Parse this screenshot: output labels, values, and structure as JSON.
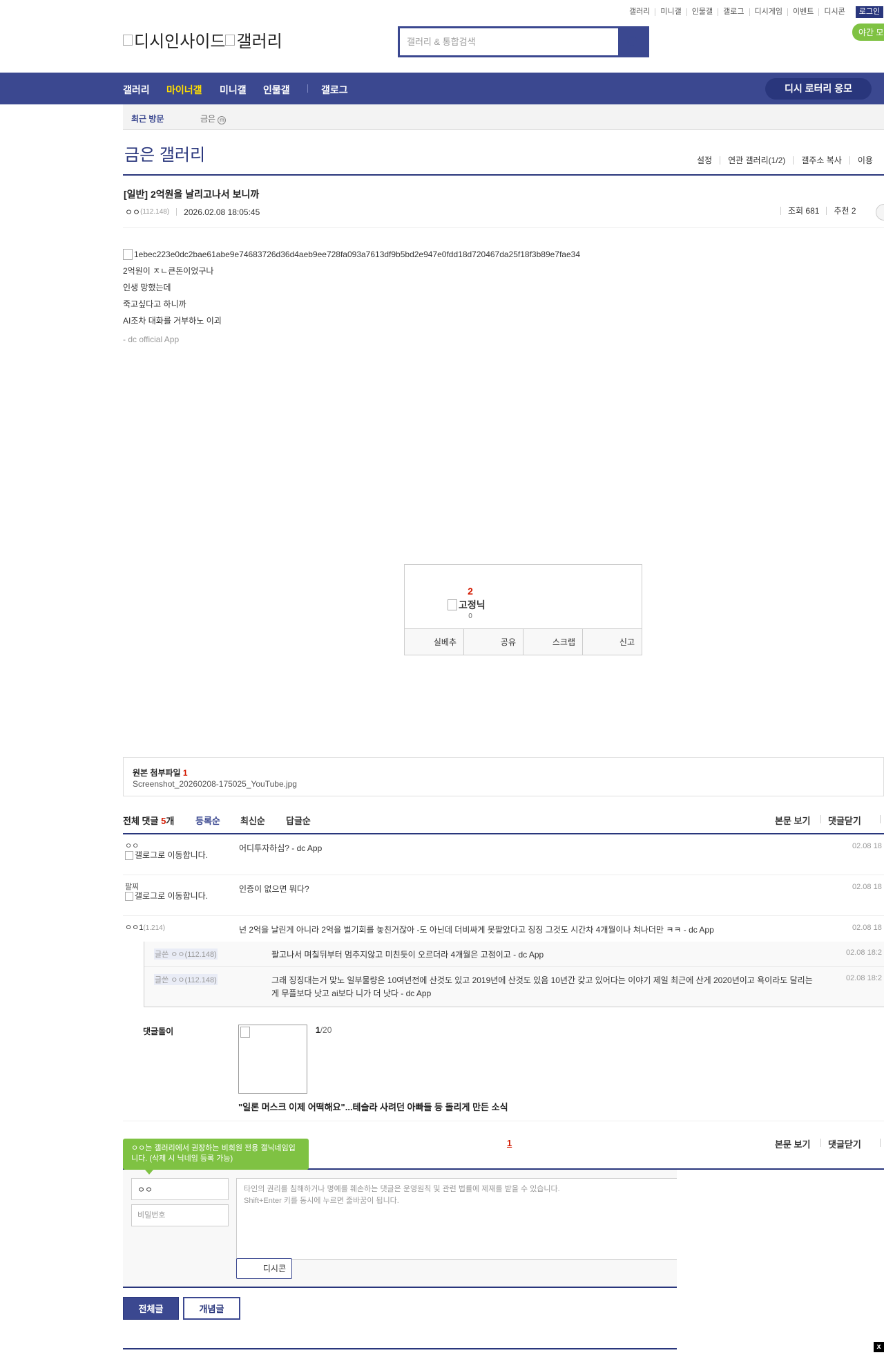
{
  "top_links": [
    "갤러리",
    "미니갤",
    "인물갤",
    "갤로그",
    "디시게임",
    "이벤트",
    "디시콘"
  ],
  "login_label": "로그인",
  "night_mode_label": "야간 모",
  "logo": {
    "left_alt": "디시인사이드",
    "right_alt": "갤러리"
  },
  "search": {
    "placeholder": "갤러리 & 통합검색"
  },
  "gnb": {
    "items": [
      "갤러리",
      "마이너갤",
      "미니갤",
      "인물갤",
      "갤로그"
    ],
    "active": "마이너갤",
    "lottery_label": "디시 로터리 응모"
  },
  "recent": {
    "title": "최근 방문",
    "item": "금은",
    "item_badge": "m"
  },
  "gallery": {
    "title": "금은 갤러리",
    "options": [
      "설정",
      "연관 갤러리(1/2)",
      "갤주소 복사",
      "이용"
    ]
  },
  "post": {
    "title": "[일반] 2억원을 날리고나서 보니까",
    "author": "ㅇㅇ",
    "author_ip": "(112.148)",
    "date": "2026.02.08 18:05:45",
    "views_label": "조회 681",
    "recommend_label": "추천 2",
    "image_alt": "1ebec223e0dc2bae61abe9e74683726d36d4aeb9ee728fa093a7613df9b5bd2e947e0fdd18d720467da25f18f3b89e7fae34",
    "lines": [
      "2억원이 ㅈㄴ큰돈이었구나",
      "인생 망했는데",
      "죽고싶다고 하니까",
      "AI조차 대화를 거부하노 이괴"
    ],
    "signature": "- dc official App"
  },
  "recommend": {
    "count": "2",
    "image_alt": "고정닉",
    "fixed_count": "0",
    "buttons": [
      "실베추",
      "공유",
      "스크랩",
      "신고"
    ]
  },
  "attachment": {
    "title": "원본 첨부파일",
    "count": "1",
    "file": "Screenshot_20260208-175025_YouTube.jpg"
  },
  "comments_header": {
    "label": "전체 댓글",
    "count": "5",
    "unit": "개",
    "sorts": [
      "등록순",
      "최신순",
      "답글순"
    ],
    "active_sort": "등록순",
    "right_buttons": [
      "본문 보기",
      "댓글닫기"
    ]
  },
  "comments": [
    {
      "nick": "ㅇㅇ",
      "ip": "",
      "image_alt": "갤로그로 이동합니다.",
      "text": "어디투자하심? - dc App",
      "date": "02.08 18"
    },
    {
      "nick": "팔찌",
      "ip": "",
      "image_alt": "갤로그로 이동합니다.",
      "text": "인증이 없으면 뭐다?",
      "date": "02.08 18"
    },
    {
      "nick": "ㅇㅇ1",
      "ip": "(1.214)",
      "image_alt": "",
      "text": "넌 2억을 날린게 아니라 2억을 벌기회를 놓친거잖아 -도 아닌데 더비싸게 못팔았다고 징징 그것도 시간차 4개월이나 쳐나더만 ㅋㅋ - dc App",
      "date": "02.08 18"
    }
  ],
  "replies": [
    {
      "nick": "글쓴 ㅇㅇ(112.148)",
      "text": "팔고나서 며칠뒤부터 멈추지않고 미친듯이 오르더라 4개월은 고점이고 - dc App",
      "date": "02.08 18:2"
    },
    {
      "nick": "글쓴 ㅇㅇ(112.148)",
      "text": "그래 징징대는거 맞노 일부물량은 10여년전에 산것도 있고 2019년에 산것도 있음 10년간 갖고 있어다는 이야기 제일 최근에 산게 2020년이고 욕이라도 달리는게 무플보다 낫고 ai보다 니가 더 낫다 - dc App",
      "date": "02.08 18:2"
    }
  ],
  "dolly": {
    "label": "댓글돌이",
    "page_current": "1",
    "page_total": "/20",
    "headline": "\"일론 머스크 이제 어떡해요\"...테슬라 사려던 아빠들 등 돌리게 만든 소식"
  },
  "pagination": {
    "current": "1"
  },
  "tooltip": {
    "text": "ㅇㅇ는 갤러리에서 권장하는 비회원 전용 갤닉네임입니다. (삭제 시 닉네임 등록 가능)"
  },
  "write": {
    "nick_value": "ㅇㅇ",
    "password_placeholder": "비밀번호",
    "textarea_placeholder": "타인의 권리를 침해하거나 명예를 훼손하는 댓글은 운영원칙 및 관련 법률에 제재를 받을 수 있습니다.\nShift+Enter 키를 동시에 누르면 줄바꿈이 됩니다.",
    "dccon_label": "디시콘"
  },
  "bottom_buttons": {
    "all": "전체글",
    "best": "개념글"
  },
  "close_label": "x",
  "colors": {
    "primary": "#3b4890",
    "dark_primary": "#29367c",
    "green": "#7fc243",
    "red": "#d31900",
    "gnb_active": "#ffde00"
  }
}
